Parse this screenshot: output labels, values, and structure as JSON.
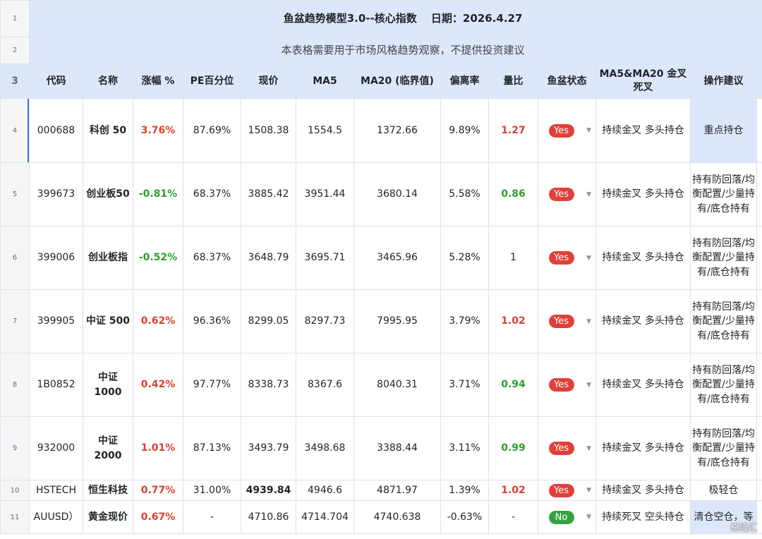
{
  "title": "鱼盆趋势模型3.0--核心指数　 日期：2026.4.27",
  "subtitle": "本表格需要用于市场风格趋势观察，不提供投资建议",
  "headers": [
    "代码",
    "名称",
    "涨幅 %",
    "PE百分位",
    "现价",
    "MA5",
    "MA20 (临界值)",
    "偏离率",
    "量比",
    "鱼盆状态",
    "MA5&MA20 金叉死叉",
    "操作建议"
  ],
  "row_numbers": [
    "1",
    "2",
    "3",
    "4",
    "5",
    "6",
    "7",
    "8",
    "9",
    "10",
    "11"
  ],
  "rows": [
    {
      "code": "000688",
      "name": "科创 50",
      "change": "3.76%",
      "pe": "87.69%",
      "price": "1508.38",
      "ma5": "1554.5",
      "ma20": "1372.66",
      "dev": "9.89%",
      "vol": "1.27",
      "status": "Yes",
      "cross": "持续金叉 多头持仓",
      "advice": "重点持仓"
    },
    {
      "code": "399673",
      "name": "创业板50",
      "change": "-0.81%",
      "pe": "68.37%",
      "price": "3885.42",
      "ma5": "3951.44",
      "ma20": "3680.14",
      "dev": "5.58%",
      "vol": "0.86",
      "status": "Yes",
      "cross": "持续金叉 多头持仓",
      "advice": "持有防回落/均衡配置/少量持有/底仓持有"
    },
    {
      "code": "399006",
      "name": "创业板指",
      "change": "-0.52%",
      "pe": "68.37%",
      "price": "3648.79",
      "ma5": "3695.71",
      "ma20": "3465.96",
      "dev": "5.28%",
      "vol": "1",
      "status": "Yes",
      "cross": "持续金叉 多头持仓",
      "advice": "持有防回落/均衡配置/少量持有/底仓持有"
    },
    {
      "code": "399905",
      "name": "中证 500",
      "change": "0.62%",
      "pe": "96.36%",
      "price": "8299.05",
      "ma5": "8297.73",
      "ma20": "7995.95",
      "dev": "3.79%",
      "vol": "1.02",
      "status": "Yes",
      "cross": "持续金叉 多头持仓",
      "advice": "持有防回落/均衡配置/少量持有/底仓持有"
    },
    {
      "code": "1B0852",
      "name": "中证 1000",
      "change": "0.42%",
      "pe": "97.77%",
      "price": "8338.73",
      "ma5": "8367.6",
      "ma20": "8040.31",
      "dev": "3.71%",
      "vol": "0.94",
      "status": "Yes",
      "cross": "持续金叉 多头持仓",
      "advice": "持有防回落/均衡配置/少量持有/底仓持有"
    },
    {
      "code": "932000",
      "name": "中证 2000",
      "change": "1.01%",
      "pe": "87.13%",
      "price": "3493.79",
      "ma5": "3498.68",
      "ma20": "3388.44",
      "dev": "3.11%",
      "vol": "0.99",
      "status": "Yes",
      "cross": "持续金叉 多头持仓",
      "advice": "持有防回落/均衡配置/少量持有/底仓持有"
    },
    {
      "code": "HSTECH",
      "name": "恒生科技",
      "change": "0.77%",
      "pe": "31.00%",
      "price": "4939.84",
      "ma5": "4946.6",
      "ma20": "4871.97",
      "dev": "1.39%",
      "vol": "1.02",
      "status": "Yes",
      "cross": "持续金叉 多头持仓",
      "advice": "极轻仓"
    },
    {
      "code": "AUUSD）",
      "name": "黄金现价",
      "change": "0.67%",
      "pe": "-",
      "price": "4710.86",
      "ma5": "4714.704",
      "ma20": "4740.638",
      "dev": "-0.63%",
      "vol": "-",
      "status": "No",
      "cross": "持续死叉 空头持仓",
      "advice": "清仓空仓，等"
    }
  ],
  "watermark": "格隆汇",
  "colors": {
    "header_bg": "#dde7fb",
    "up": "#e03e2d",
    "down": "#2ca02c",
    "yes_pill": "#e0403a",
    "no_pill": "#35a341"
  }
}
